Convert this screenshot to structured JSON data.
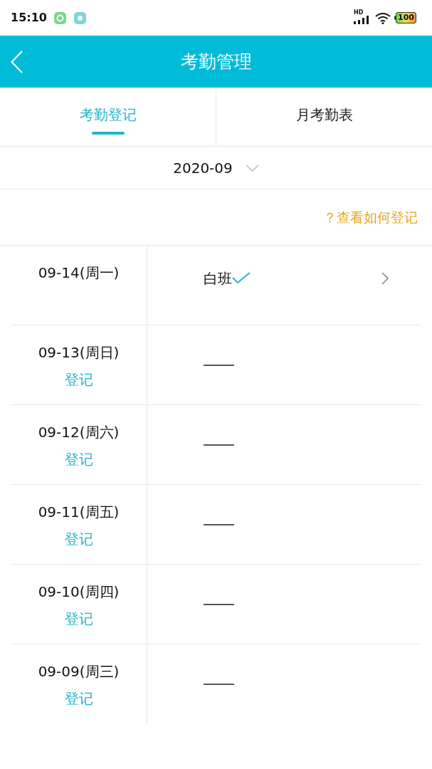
{
  "status_bar": {
    "time": "15:10",
    "network": "HD",
    "battery": "100"
  },
  "header": {
    "title": "考勤管理"
  },
  "tabs": [
    {
      "label": "考勤登记",
      "selected": true
    },
    {
      "label": "月考勤表",
      "selected": false
    }
  ],
  "month_picker": {
    "value": "2020-09"
  },
  "help_link": {
    "label": "？查看如何登记"
  },
  "records": [
    {
      "kind": "shift",
      "date": "09-14(周一)",
      "shift": "白班",
      "checked": true
    },
    {
      "kind": "empty",
      "date": "09-13(周日)",
      "action": "登记"
    },
    {
      "kind": "empty",
      "date": "09-12(周六)",
      "action": "登记"
    },
    {
      "kind": "empty",
      "date": "09-11(周五)",
      "action": "登记"
    },
    {
      "kind": "empty",
      "date": "09-10(周四)",
      "action": "登记"
    },
    {
      "kind": "empty",
      "date": "09-09(周三)",
      "action": "登记"
    }
  ]
}
